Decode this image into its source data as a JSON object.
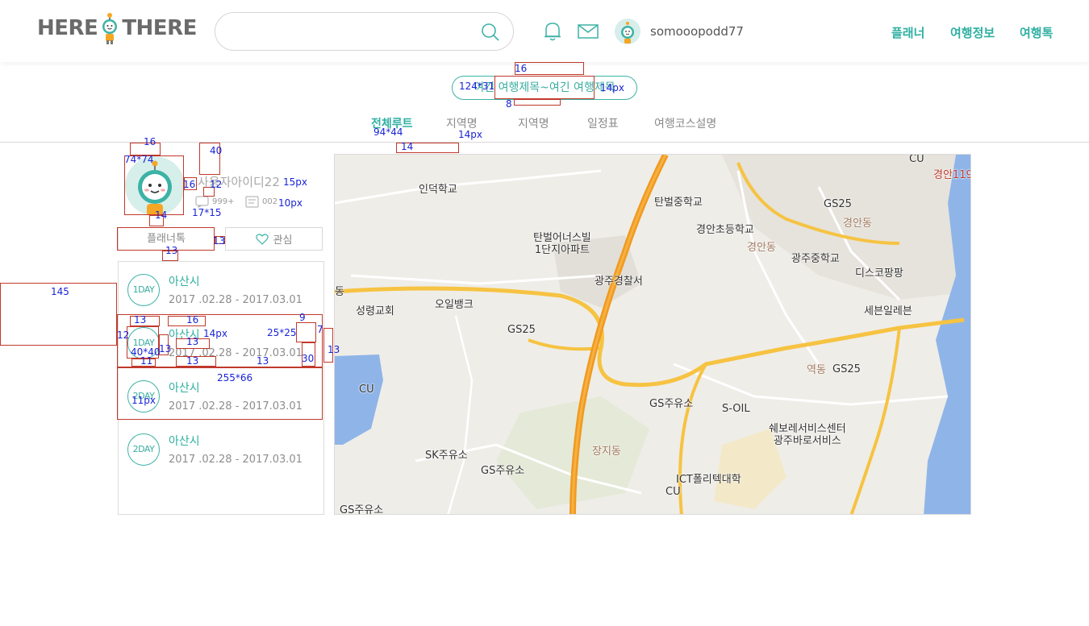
{
  "header": {
    "logo_left": "HERE",
    "logo_right": "THERE",
    "search": {
      "value": "",
      "placeholder": ""
    },
    "username": "somooopodd77",
    "nav": [
      "플래너",
      "여행정보",
      "여행톡"
    ]
  },
  "title_pill": "여긴 여행제목~여긴 여행제목",
  "tabs": [
    {
      "label": "전체루트",
      "active": true
    },
    {
      "label": "지역명",
      "active": false
    },
    {
      "label": "지역명",
      "active": false
    },
    {
      "label": "일정표",
      "active": false
    },
    {
      "label": "여행코스설명",
      "active": false
    }
  ],
  "profile": {
    "name": "사용자아이디22",
    "stat1": "999+",
    "stat2": "002",
    "planner_button": "플래너톡",
    "like_button": "관심"
  },
  "routes": [
    {
      "day": "1DAY",
      "city": "아산시",
      "dates": "2017 .02.28  -  2017.03.01"
    },
    {
      "day": "1DAY",
      "city": "아산시",
      "dates": "2017 .02.28  -  2017.03.01"
    },
    {
      "day": "2DAY",
      "city": "아산시",
      "dates": "2017 .02.28  -  2017.03.01"
    },
    {
      "day": "2DAY",
      "city": "아산시",
      "dates": "2017 .02.28  -  2017.03.01"
    }
  ],
  "map_labels": [
    "인덕학교",
    "탄벌중학교",
    "경안초등학교",
    "GS25",
    "경안동",
    "경안119",
    "CU",
    "탄벌어너스빌\n1단지아파트",
    "경안동",
    "광주중학교",
    "디스코팡팡",
    "광주경찰서",
    "오일뱅크",
    "성령교회",
    "GS25",
    "세븐일레븐",
    "역동",
    "GS25",
    "CU",
    "GS주유소",
    "S-OIL",
    "쉐보레서비스센터\n광주바로서비스",
    "장지동",
    "SK주유소",
    "GS주유소",
    "ICT폴리텍대학",
    "CU",
    "GS주유소",
    "동"
  ],
  "annotations": [
    "16",
    "124*31",
    "14px",
    "8",
    "94*44",
    "14px",
    "14",
    "16",
    "74*74",
    "40",
    "16",
    "12",
    "15px",
    "17*15",
    "10px",
    "14",
    "13",
    "13",
    "145",
    "13",
    "16",
    "9",
    "12",
    "14px",
    "25*25",
    "7",
    "13",
    "40*40",
    "13",
    "13",
    "30",
    "13",
    "11",
    "13",
    "11px",
    "255*66",
    "11px"
  ],
  "colors": {
    "accent": "#2fb0a2",
    "annotation_box": "#c0392b",
    "annotation_text": "#1a24d6"
  },
  "icons": [
    "search-icon",
    "bell-icon",
    "mail-icon",
    "heart-icon",
    "chat-icon",
    "note-icon",
    "mascot-icon"
  ]
}
